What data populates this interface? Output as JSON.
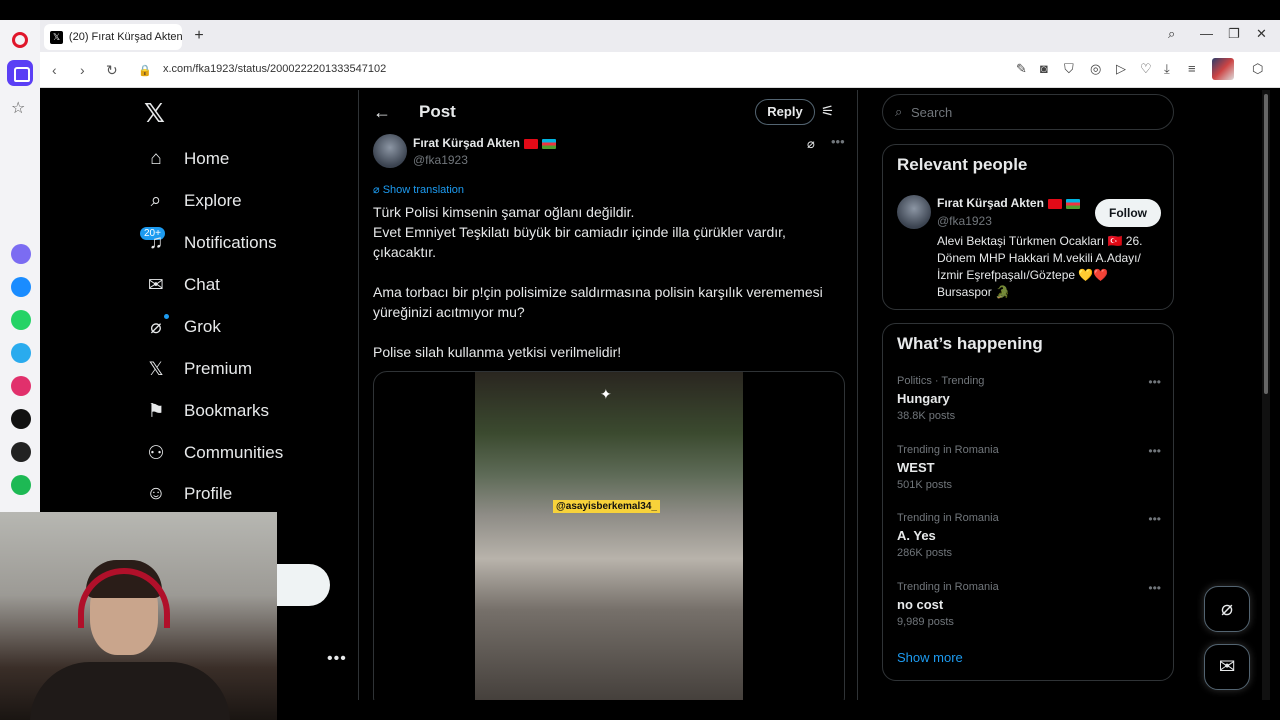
{
  "browser": {
    "tab_title": "(20) Fırat Kürşad Akten",
    "tab_icon": "x-logo-icon",
    "url": "x.com/fka1923/status/2000222201333547102"
  },
  "nav": {
    "items": [
      {
        "label": "Home",
        "icon": "home-icon"
      },
      {
        "label": "Explore",
        "icon": "search-icon"
      },
      {
        "label": "Notifications",
        "icon": "bell-icon"
      },
      {
        "label": "Chat",
        "icon": "mail-icon"
      },
      {
        "label": "Grok",
        "icon": "grok-icon"
      },
      {
        "label": "Premium",
        "icon": "x-logo-icon"
      },
      {
        "label": "Bookmarks",
        "icon": "bookmark-icon"
      },
      {
        "label": "Communities",
        "icon": "people-icon"
      },
      {
        "label": "Profile",
        "icon": "person-icon"
      }
    ],
    "notification_badge": "20+"
  },
  "post": {
    "header_title": "Post",
    "reply_label": "Reply",
    "author_name": "Fırat Kürşad Akten",
    "author_handle": "@fka1923",
    "show_translation": "Show translation",
    "text": "Türk Polisi kimsenin şamar oğlanı değildir.\nEvet Emniyet Teşkilatı büyük bir camiadır içinde illa çürükler vardır, çıkacaktır.\n\nAma torbacı bir p!çin polisimize saldırmasına polisin karşılık verememesi yüreğinizi acıtmıyor mu?\n\nPolise silah kullanma yetkisi verilmelidir!",
    "video_watermark": "@asayisberkemal34_"
  },
  "sidebar": {
    "search_placeholder": "Search",
    "relevant_people": {
      "title": "Relevant people",
      "name": "Fırat Kürşad Akten",
      "handle": "@fka1923",
      "follow_label": "Follow",
      "bio": "Alevi Bektaşi Türkmen Ocakları 🇹🇷 26. Dönem MHP Hakkari M.vekili A.Adayı/ İzmir Eşrefpaşalı/Göztepe 💛❤️ Bursaspor 🐊"
    },
    "whats_happening": {
      "title": "What’s happening",
      "trends": [
        {
          "context": "Politics · Trending",
          "name": "Hungary",
          "posts": "38.8K posts"
        },
        {
          "context": "Trending in Romania",
          "name": "WEST",
          "posts": "501K posts"
        },
        {
          "context": "Trending in Romania",
          "name": "A. Yes",
          "posts": "286K posts"
        },
        {
          "context": "Trending in Romania",
          "name": "no cost",
          "posts": "9,989 posts"
        }
      ],
      "show_more": "Show more"
    }
  },
  "colors": {
    "background": "#000000",
    "accent": "#1d9bf0",
    "text": "#e7e9ea",
    "muted": "#71767b"
  }
}
